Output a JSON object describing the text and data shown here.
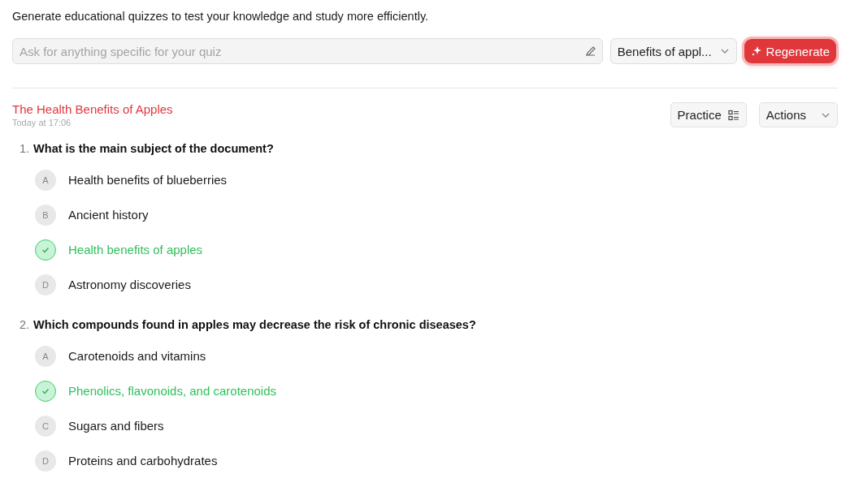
{
  "intro": "Generate educational quizzes to test your knowledge and study more efficiently.",
  "prompt": {
    "placeholder": "Ask for anything specific for your quiz"
  },
  "document_select": {
    "value": "Benefits of appl..."
  },
  "regenerate_button": "Regenerate",
  "quiz": {
    "title": "The Health Benefits of Apples",
    "timestamp": "Today at 17:06",
    "practice_button": "Practice",
    "actions_button": "Actions"
  },
  "questions": [
    {
      "number": "1.",
      "text": "What is the main subject of the document?",
      "options": [
        {
          "letter": "A",
          "text": "Health benefits of blueberries",
          "correct": false
        },
        {
          "letter": "B",
          "text": "Ancient history",
          "correct": false
        },
        {
          "text": "Health benefits of apples",
          "correct": true
        },
        {
          "letter": "D",
          "text": "Astronomy discoveries",
          "correct": false
        }
      ]
    },
    {
      "number": "2.",
      "text": "Which compounds found in apples may decrease the risk of chronic diseases?",
      "options": [
        {
          "letter": "A",
          "text": "Carotenoids and vitamins",
          "correct": false
        },
        {
          "text": "Phenolics, flavonoids, and carotenoids",
          "correct": true
        },
        {
          "letter": "C",
          "text": "Sugars and fibers",
          "correct": false
        },
        {
          "letter": "D",
          "text": "Proteins and carbohydrates",
          "correct": false
        }
      ]
    }
  ]
}
